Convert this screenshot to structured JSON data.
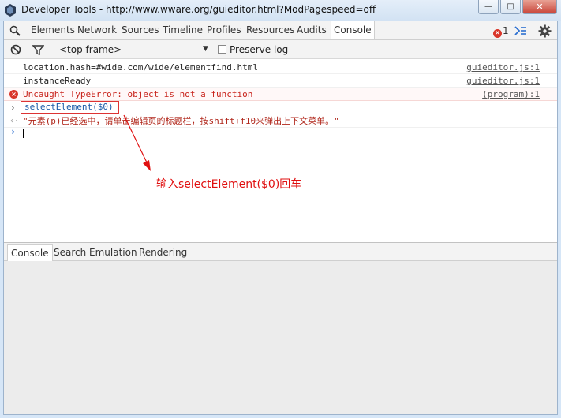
{
  "window": {
    "title": "Developer Tools - http://www.wware.org/guieditor.html?ModPagespeed=off"
  },
  "tabs": [
    "Elements",
    "Network",
    "Sources",
    "Timeline",
    "Profiles",
    "Resources",
    "Audits",
    "Console"
  ],
  "active_tab": "Console",
  "error_count": "1",
  "toolbar": {
    "frame_select": "<top frame>",
    "preserve_log_label": "Preserve log",
    "preserve_log_checked": false
  },
  "console": {
    "messages": [
      {
        "text": "location.hash=#wide.com/wide/elementfind.html",
        "source": "guieditor.js:1"
      },
      {
        "text": "instanceReady",
        "source": "guieditor.js:1"
      },
      {
        "text": "Uncaught TypeError: object is not a function",
        "source": "(program):1"
      }
    ],
    "command": "selectElement($0)",
    "result": "\"元素(p)已经选中，请单击编辑页的标题栏，按shift+f10来弹出上下文菜单。\"",
    "annotation": "输入selectElement($0)回车"
  },
  "drawer": {
    "tabs": [
      "Console",
      "Search",
      "Emulation",
      "Rendering"
    ],
    "active": "Console"
  },
  "colors": {
    "error": "#c8231b",
    "annotation": "#e01010",
    "prompt": "#2c6fd0"
  }
}
